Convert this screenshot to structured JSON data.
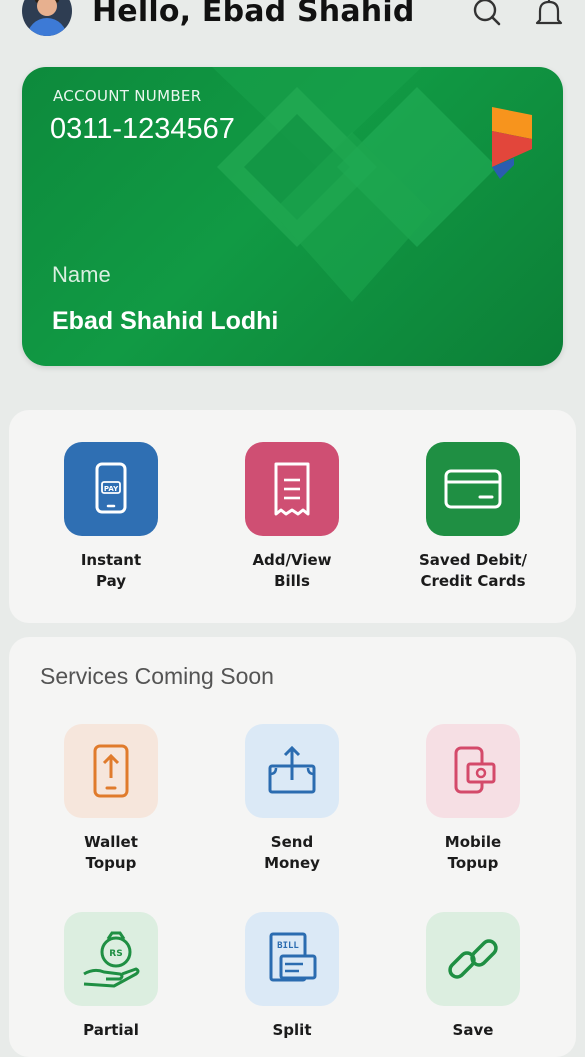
{
  "header": {
    "greeting": "Hello, Ebad Shahid",
    "icons": [
      "avatar",
      "search-icon",
      "bell-icon"
    ]
  },
  "card": {
    "account_label": "ACCOUNT NUMBER",
    "account_number": "0311-1234567",
    "name_label": "Name",
    "name_value": "Ebad Shahid Lodhi",
    "color": "#0f9142"
  },
  "quick_actions": [
    {
      "line1": "Instant",
      "line2": "Pay",
      "icon": "phone-pay-icon",
      "color": "#2f6fb3",
      "badge": "PAY"
    },
    {
      "line1": "Add/View",
      "line2": "Bills",
      "icon": "receipt-icon",
      "color": "#cf4f73"
    },
    {
      "line1": "Saved Debit/",
      "line2": "Credit Cards",
      "icon": "credit-card-icon",
      "color": "#1f8f43"
    }
  ],
  "services": {
    "title": "Services Coming Soon",
    "items": [
      {
        "line1": "Wallet",
        "line2": "Topup",
        "icon": "phone-upload-icon",
        "color": "#f6e6dc"
      },
      {
        "line1": "Send",
        "line2": "Money",
        "icon": "send-money-icon",
        "color": "#dbe9f6"
      },
      {
        "line1": "Mobile",
        "line2": "Topup",
        "icon": "mobile-cash-icon",
        "color": "#f6dfe4"
      },
      {
        "line1": "Partial",
        "line2": "",
        "icon": "money-bag-hand-icon",
        "color": "#dceee0",
        "badge": "RS"
      },
      {
        "line1": "Split",
        "line2": "",
        "icon": "bill-icon",
        "color": "#dbe9f6",
        "badge": "BILL"
      },
      {
        "line1": "Save",
        "line2": "",
        "icon": "link-icon",
        "color": "#dceee0"
      }
    ]
  }
}
